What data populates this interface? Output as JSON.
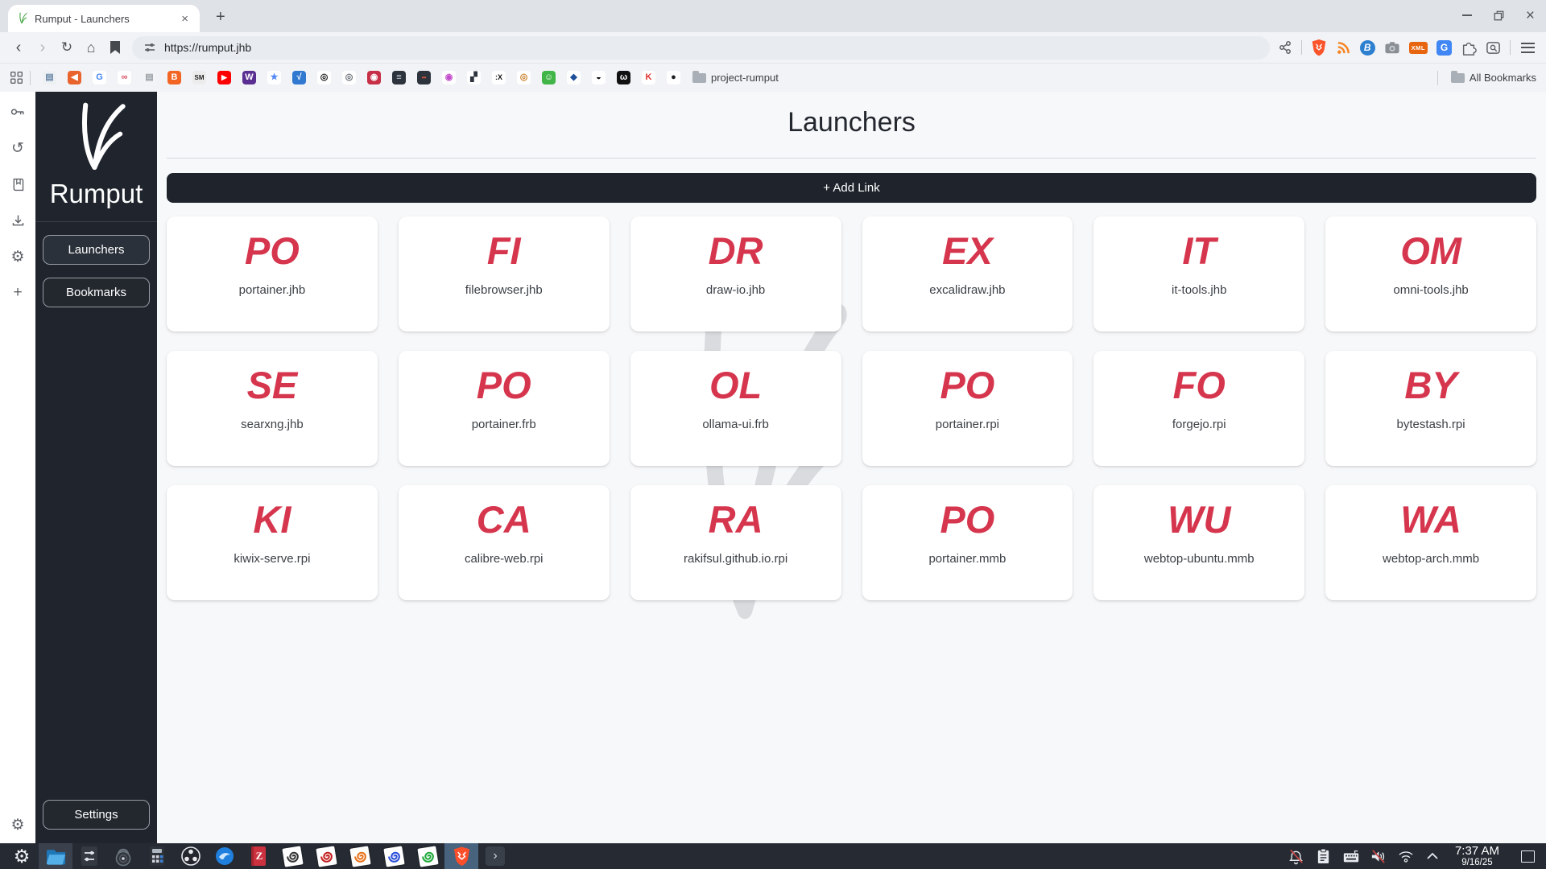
{
  "icons": {
    "back": "‹",
    "forward": "›",
    "reload": "↻",
    "home": "⌂",
    "close_tab": "×",
    "new_tab": "+",
    "close_window": "×",
    "history": "↺",
    "gear": "⚙",
    "plus": "+",
    "expander": "›"
  },
  "browser": {
    "tab_title": "Rumput - Launchers",
    "url": "https://rumput.jhb",
    "bookmarks_bar": {
      "project_folder": "project-rumput",
      "all_bookmarks": "All Bookmarks",
      "favicons": [
        {
          "name": "clipboard-favicon",
          "bg": "#eef1f4",
          "fg": "#6b89a8",
          "glyph": "▤"
        },
        {
          "name": "megaphone-favicon",
          "bg": "#e8642c",
          "fg": "#ffffff",
          "glyph": "◀"
        },
        {
          "name": "google-favicon",
          "bg": "#ffffff",
          "fg": "#4285F4",
          "glyph": "G"
        },
        {
          "name": "rings-favicon",
          "bg": "#ffffff",
          "fg": "#d45063",
          "glyph": "∞"
        },
        {
          "name": "document-favicon",
          "bg": "#f3f4f6",
          "fg": "#9aa0a6",
          "glyph": "▤"
        },
        {
          "name": "b-orange-favicon",
          "bg": "#f26522",
          "fg": "#ffffff",
          "glyph": "B"
        },
        {
          "name": "sm-favicon",
          "bg": "#ececec",
          "fg": "#222222",
          "glyph": "SM",
          "fs": "8px"
        },
        {
          "name": "youtube-favicon",
          "bg": "#ff0000",
          "fg": "#ffffff",
          "glyph": "▶",
          "fs": "9px"
        },
        {
          "name": "wikipedia-w-favicon",
          "bg": "#5b2e91",
          "fg": "#ffffff",
          "glyph": "W"
        },
        {
          "name": "gemini-star-favicon",
          "bg": "#ffffff",
          "fg": "#5087f5",
          "glyph": "★"
        },
        {
          "name": "sqrt-blue-favicon",
          "bg": "#3178d0",
          "fg": "#ffffff",
          "glyph": "√"
        },
        {
          "name": "openai-favicon",
          "bg": "#ffffff",
          "fg": "#1a1a1a",
          "glyph": "◎"
        },
        {
          "name": "swirl-gray-favicon",
          "bg": "#ffffff",
          "fg": "#6a6f76",
          "glyph": "◎"
        },
        {
          "name": "red-shield-favicon",
          "bg": "#c62f45",
          "fg": "#ffffff",
          "glyph": "◉"
        },
        {
          "name": "server-favicon",
          "bg": "#2d333c",
          "fg": "#d0d4da",
          "glyph": "≡"
        },
        {
          "name": "two-dots-favicon",
          "bg": "#2d333c",
          "fg": "#e4593b",
          "glyph": "••",
          "fs": "8px"
        },
        {
          "name": "firefox-favicon",
          "bg": "#ffffff",
          "fg": "#c24ccb",
          "glyph": "◉"
        },
        {
          "name": "blocks-favicon",
          "bg": "#ffffff",
          "fg": "#2d333c",
          "glyph": "▞"
        },
        {
          "name": "ex-favicon",
          "bg": "#ffffff",
          "fg": "#111111",
          "glyph": ":X",
          "fs": "9px"
        },
        {
          "name": "swirl-orange-favicon",
          "bg": "#ffffff",
          "fg": "#c9822f",
          "glyph": "◎"
        },
        {
          "name": "tokopedia-favicon",
          "bg": "#42b549",
          "fg": "#ffffff",
          "glyph": "☺"
        },
        {
          "name": "bca-favicon",
          "bg": "#ffffff",
          "fg": "#1e4f9c",
          "glyph": "◆"
        },
        {
          "name": "eye-favicon",
          "bg": "#ffffff",
          "fg": "#111111",
          "glyph": "◒"
        },
        {
          "name": "cat-favicon",
          "bg": "#111111",
          "fg": "#ffffff",
          "glyph": "ω"
        },
        {
          "name": "k-red-favicon",
          "bg": "#ffffff",
          "fg": "#e03131",
          "glyph": "K"
        },
        {
          "name": "github-favicon",
          "bg": "#ffffff",
          "fg": "#1b1f23",
          "glyph": "●"
        }
      ]
    }
  },
  "app": {
    "brand": "Rumput",
    "accent": "#d6364d",
    "page_title": "Launchers",
    "add_link_label": "+ Add Link",
    "nav": [
      {
        "label": "Launchers",
        "active": true
      },
      {
        "label": "Bookmarks",
        "active": false
      }
    ],
    "settings_label": "Settings",
    "cards": [
      {
        "initials": "PO",
        "label": "portainer.jhb"
      },
      {
        "initials": "FI",
        "label": "filebrowser.jhb"
      },
      {
        "initials": "DR",
        "label": "draw-io.jhb"
      },
      {
        "initials": "EX",
        "label": "excalidraw.jhb"
      },
      {
        "initials": "IT",
        "label": "it-tools.jhb"
      },
      {
        "initials": "OM",
        "label": "omni-tools.jhb"
      },
      {
        "initials": "SE",
        "label": "searxng.jhb"
      },
      {
        "initials": "PO",
        "label": "portainer.frb"
      },
      {
        "initials": "OL",
        "label": "ollama-ui.frb"
      },
      {
        "initials": "PO",
        "label": "portainer.rpi"
      },
      {
        "initials": "FO",
        "label": "forgejo.rpi"
      },
      {
        "initials": "BY",
        "label": "bytestash.rpi"
      },
      {
        "initials": "KI",
        "label": "kiwix-serve.rpi"
      },
      {
        "initials": "CA",
        "label": "calibre-web.rpi"
      },
      {
        "initials": "RA",
        "label": "rakifsul.github.io.rpi"
      },
      {
        "initials": "PO",
        "label": "portainer.mmb"
      },
      {
        "initials": "WU",
        "label": "webtop-ubuntu.mmb"
      },
      {
        "initials": "WA",
        "label": "webtop-arch.mmb"
      }
    ]
  },
  "taskbar": {
    "clock": {
      "time": "7:37 AM",
      "date": "9/16/25"
    },
    "app_icons": [
      "application-menu",
      "file-manager",
      "settings-manager",
      "password-safe",
      "calculator",
      "obs-studio",
      "thunderbird",
      "zotero",
      "viewer-gray",
      "viewer-red",
      "viewer-orange",
      "viewer-blue",
      "viewer-green",
      "brave-browser",
      "panel-expander"
    ],
    "tray_icons": [
      "notifications-muted",
      "clipboard-manager",
      "keyboard-layout",
      "volume-muted",
      "network-wireless",
      "expand-tray"
    ]
  }
}
